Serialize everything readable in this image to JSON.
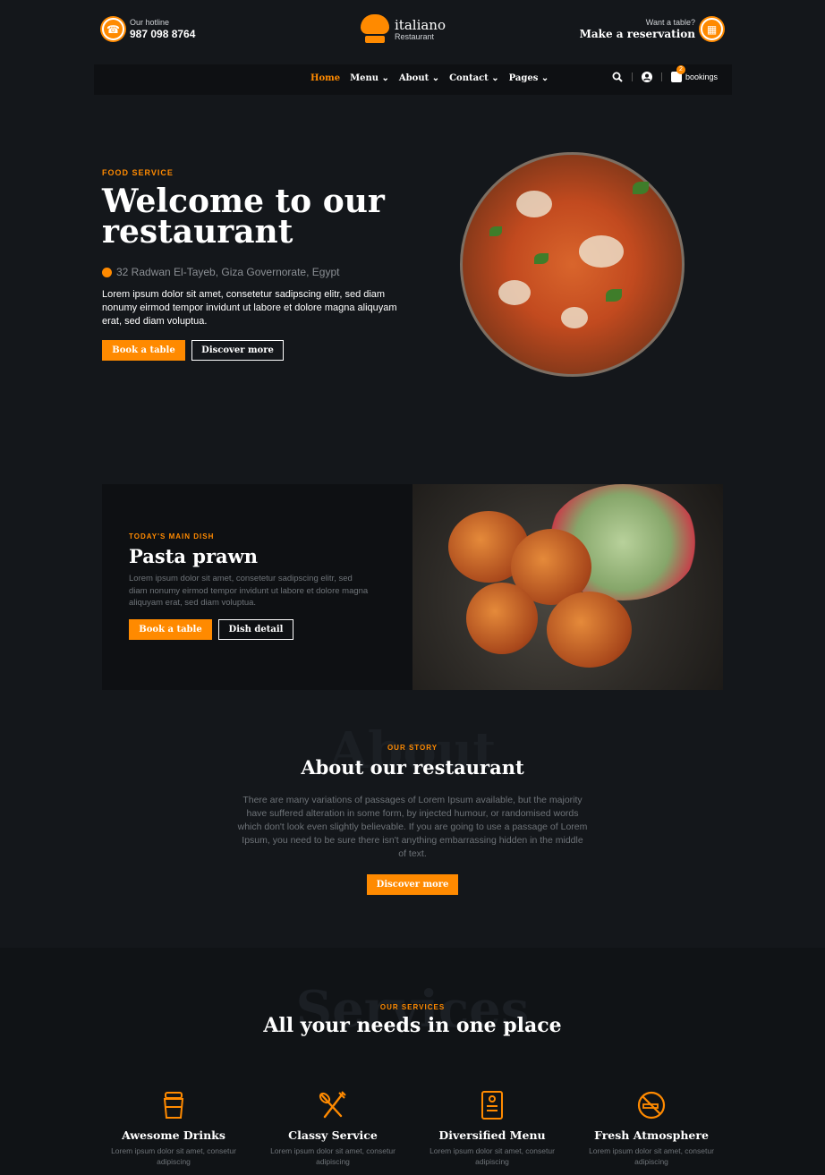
{
  "header": {
    "hotline_label": "Our hotline",
    "hotline_number": "987 098 8764",
    "logo_name": "italiano",
    "logo_sub": "Restaurant",
    "reserve_label": "Want a table?",
    "reserve_link": "Make a reservation"
  },
  "nav": {
    "items": [
      {
        "label": "Home"
      },
      {
        "label": "Menu ⌄"
      },
      {
        "label": "About ⌄"
      },
      {
        "label": "Contact ⌄"
      },
      {
        "label": "Pages ⌄"
      }
    ],
    "bookings_label": "bookings",
    "bookings_count": "2"
  },
  "hero": {
    "eyebrow": "FOOD SERVICE",
    "title": "Welcome to our restaurant",
    "address": "32 Radwan El-Tayeb, Giza Governorate, Egypt",
    "text": "Lorem ipsum dolor sit amet, consetetur sadipscing elitr, sed diam nonumy eirmod tempor invidunt ut labore et dolore magna aliquyam erat, sed diam voluptua.",
    "btn_primary": "Book a table",
    "btn_secondary": "Discover more"
  },
  "main_dish": {
    "eyebrow": "TODAY'S MAIN DISH",
    "title": "Pasta prawn",
    "text": "Lorem ipsum dolor sit amet, consetetur sadipscing elitr, sed diam nonumy eirmod tempor invidunt ut labore et dolore magna aliquyam erat, sed diam voluptua.",
    "btn_primary": "Book a table",
    "btn_secondary": "Dish detail"
  },
  "about": {
    "ghost": "About",
    "eyebrow": "OUR STORY",
    "title": "About our restaurant",
    "text": "There are many variations of passages of Lorem Ipsum available, but the majority have suffered alteration in some form, by injected humour, or randomised words which don't look even slightly believable. If you are going to use a passage of Lorem Ipsum, you need to be sure there isn't anything embarrassing hidden in the middle of text.",
    "btn": "Discover more"
  },
  "services": {
    "ghost": "Services",
    "eyebrow": "OUR SERVICES",
    "title": "All your needs in one place",
    "items": [
      {
        "title": "Awesome Drinks",
        "desc": "Lorem ipsum dolor sit amet, consetur adipiscing",
        "icon": "cup-icon"
      },
      {
        "title": "Classy Service",
        "desc": "Lorem ipsum dolor sit amet, consetur adipiscing",
        "icon": "cutlery-icon"
      },
      {
        "title": "Diversified Menu",
        "desc": "Lorem ipsum dolor sit amet, consetur adipiscing",
        "icon": "menu-icon"
      },
      {
        "title": "Fresh Atmosphere",
        "desc": "Lorem ipsum dolor sit amet, consetur adipiscing",
        "icon": "no-smoking-icon"
      }
    ]
  },
  "colors": {
    "accent": "#ff8a00",
    "background": "#14171b"
  }
}
